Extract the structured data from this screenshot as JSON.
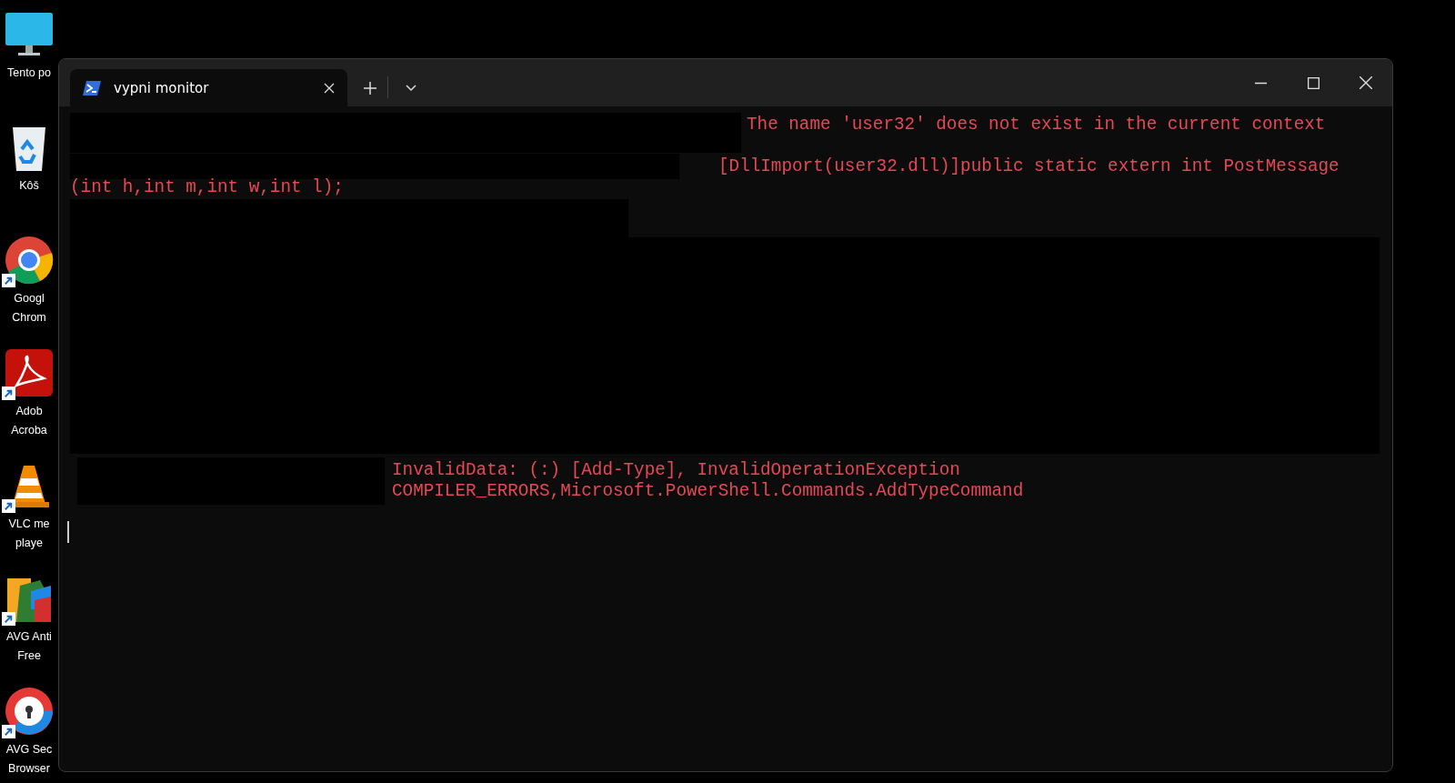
{
  "desktop_icons": [
    {
      "label": [
        "Tento po"
      ],
      "shortcut": false
    },
    {
      "label": [
        "Kôš"
      ],
      "shortcut": false
    },
    {
      "label": [
        "Googl",
        "Chrom"
      ],
      "shortcut": true
    },
    {
      "label": [
        "Adob",
        "Acroba"
      ],
      "shortcut": true
    },
    {
      "label": [
        "VLC me",
        "playe"
      ],
      "shortcut": true
    },
    {
      "label": [
        "AVG Anti",
        "Free"
      ],
      "shortcut": true
    },
    {
      "label": [
        "AVG Sec",
        "Browser"
      ],
      "shortcut": true
    }
  ],
  "window": {
    "tabs": [
      {
        "title": "vypni monitor",
        "selected": true
      }
    ]
  },
  "terminal": {
    "lines": [
      "The name 'user32' does not exist in the current context",
      "[DllImport(user32.dll)]public static extern int PostMessage",
      "(int h,int m,int w,int l);",
      "InvalidData: (:) [Add-Type], InvalidOperationException",
      "COMPILER_ERRORS,Microsoft.PowerShell.Commands.AddTypeCommand"
    ],
    "cursor": true
  }
}
